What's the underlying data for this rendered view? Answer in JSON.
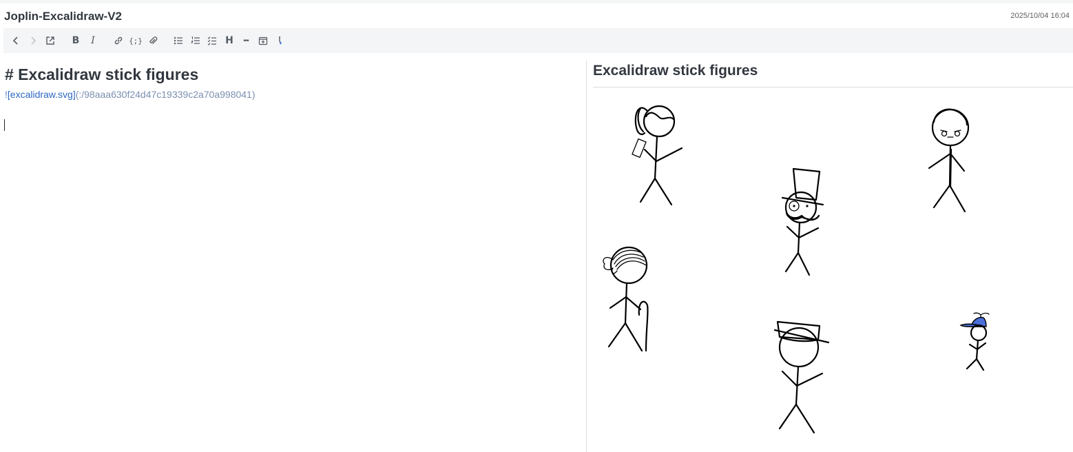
{
  "window": {
    "title": "Joplin-Excalidraw-V2",
    "date": "2025/10/04 16:04"
  },
  "toolbar": {
    "buttons": [
      {
        "name": "back",
        "icon": "chevron-left-icon",
        "enabled": true
      },
      {
        "name": "forward",
        "icon": "chevron-right-icon",
        "enabled": false
      },
      {
        "name": "external-edit",
        "icon": "external-link-icon",
        "enabled": true
      },
      {
        "name": "bold",
        "label": "B"
      },
      {
        "name": "italic",
        "label": "I"
      },
      {
        "name": "link",
        "icon": "link-icon"
      },
      {
        "name": "code",
        "label": "{;}"
      },
      {
        "name": "attach",
        "icon": "paperclip-icon"
      },
      {
        "name": "bullet-list",
        "icon": "bullet-list-icon"
      },
      {
        "name": "numbered-list",
        "icon": "numbered-list-icon"
      },
      {
        "name": "checklist",
        "icon": "checklist-icon"
      },
      {
        "name": "heading",
        "label": "H"
      },
      {
        "name": "horizontal-rule",
        "label": "•••"
      },
      {
        "name": "insert-datetime",
        "icon": "calendar-plus-icon"
      },
      {
        "name": "spell-check",
        "icon": "spellcheck-icon"
      }
    ]
  },
  "editor": {
    "heading_line": "# Excalidraw stick figures",
    "link_bang": "!",
    "link_text": "[excalidraw.svg]",
    "link_url": "(:/98aaa630f24d47c19339c2a70a998041)"
  },
  "viewer": {
    "heading": "Excalidraw stick figures",
    "figures": [
      "ponytail-phone-figure",
      "top-hat-monocle-figure",
      "tired-eyes-figure",
      "bun-hair-cane-figure",
      "hat-figure",
      "propeller-cap-figure"
    ],
    "cap_color": "#4a6fd8"
  }
}
